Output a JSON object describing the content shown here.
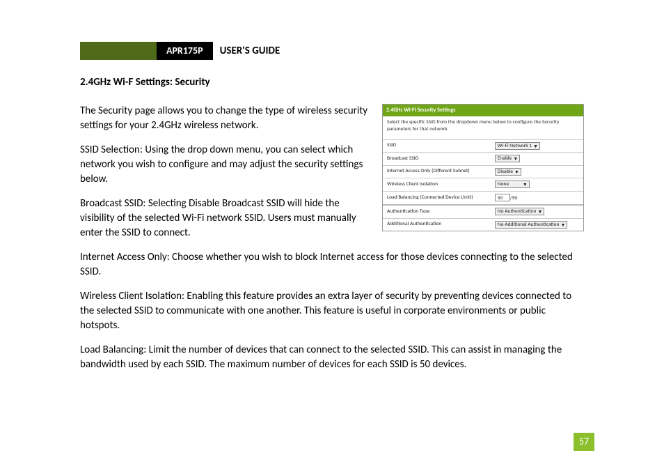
{
  "header": {
    "code": "APR175P",
    "title": "USER'S GUIDE"
  },
  "section_title": "2.4GHz Wi-F Settings: Security",
  "paragraphs": {
    "p1": "The Security page allows you to change the type of wireless security settings for your 2.4GHz wireless network.",
    "p2": "SSID Selection: Using the drop down menu, you can select which network you wish to configure and may adjust the security settings below.",
    "p3": "Broadcast SSID: Selecting Disable Broadcast SSID will hide the visibility of the selected Wi-Fi network SSID.  Users must manually enter the SSID to connect.",
    "p4": "Internet Access Only: Choose whether you wish to block Internet access for those devices connecting to the selected SSID.",
    "p5": "Wireless Client Isolation: Enabling this feature provides an extra layer of security by preventing devices connected to the selected SSID to communicate with one another.  This feature is useful in corporate environments or public hotspots.",
    "p6": "Load Balancing: Limit the number of devices that can connect to the selected SSID.  This can assist in managing the bandwidth used by each SSID.  The maximum number of devices for each SSID is 50 devices."
  },
  "panel": {
    "title": "2.4GHz Wi-Fi Security Settings",
    "desc": "Select the specific SSID from the dropdown menu below to configure the Security parameters for that network.",
    "rows": {
      "ssid_label": "SSID",
      "ssid_value": "Wi-Fi Network 1",
      "broadcast_label": "Broadcast SSID",
      "broadcast_value": "Enable",
      "internet_label": "Internet Access Only (Different Subnet)",
      "internet_value": "Disable",
      "isolation_label": "Wireless Client Isolation",
      "isolation_value": "None",
      "loadbal_label": "Load Balancing (Connected Device Limit)",
      "loadbal_value": "50",
      "loadbal_max": "/50",
      "auth_label": "Authentication Type",
      "auth_value": "No Authentication",
      "addauth_label": "Additional Authentication",
      "addauth_value": "No Additional Authentication"
    }
  },
  "page_number": "57"
}
